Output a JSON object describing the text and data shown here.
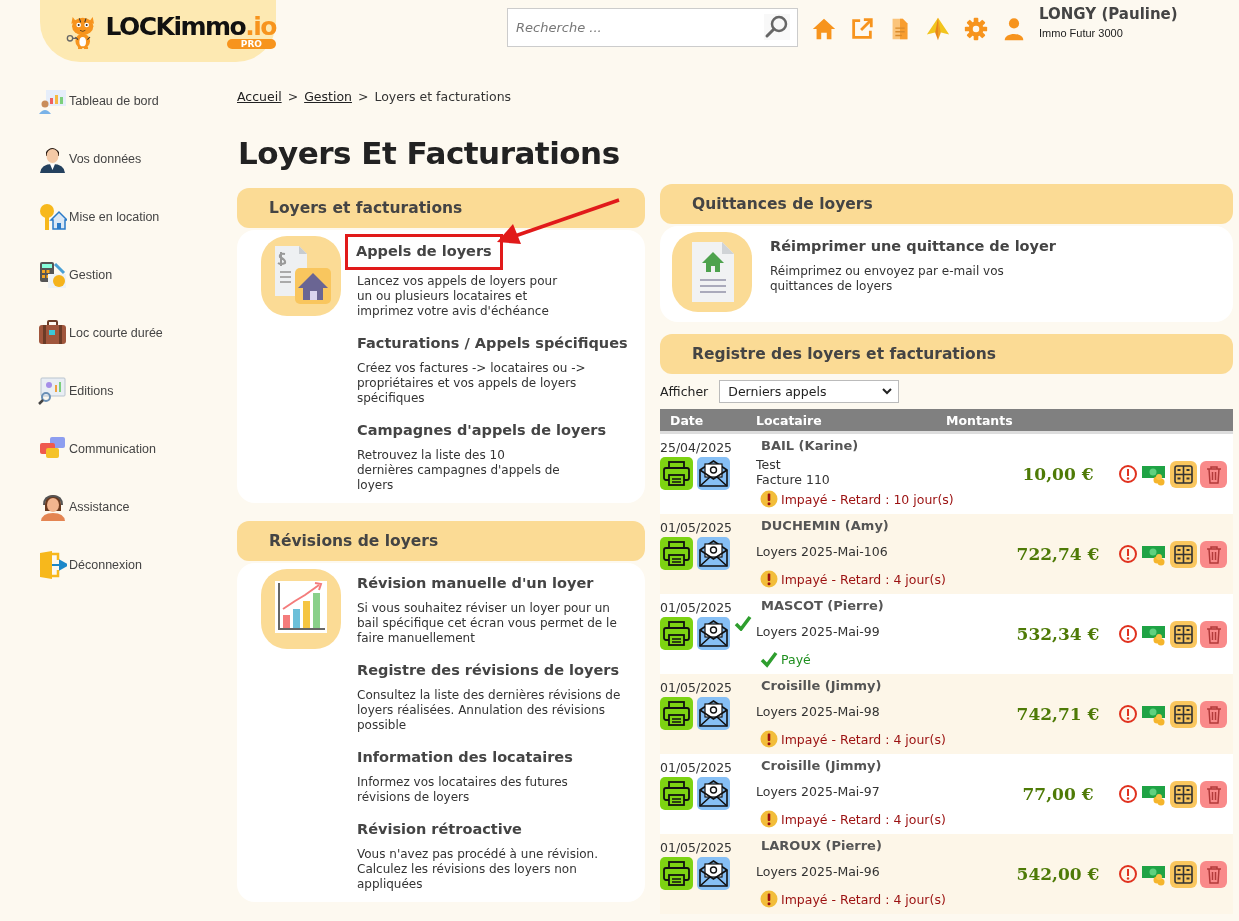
{
  "header": {
    "logo": {
      "name": "LOCKimmo",
      "suffix": ".io",
      "badge": "PRO"
    },
    "search": {
      "placeholder": "Recherche ..."
    },
    "user": {
      "name": "LONGY (Pauline)",
      "company": "Immo Futur 3000"
    }
  },
  "sidebar": {
    "items": [
      {
        "label": "Tableau de bord"
      },
      {
        "label": "Vos données"
      },
      {
        "label": "Mise en location"
      },
      {
        "label": "Gestion"
      },
      {
        "label": "Loc courte durée"
      },
      {
        "label": "Editions"
      },
      {
        "label": "Communication"
      },
      {
        "label": "Assistance"
      },
      {
        "label": "Déconnexion"
      }
    ]
  },
  "breadcrumb": {
    "separator": ">",
    "items": [
      {
        "label": "Accueil",
        "link": true
      },
      {
        "label": "Gestion",
        "link": true
      },
      {
        "label": "Loyers et facturations",
        "link": false
      }
    ]
  },
  "page_title": "Loyers Et Facturations",
  "left_panels": [
    {
      "title": "Loyers et facturations",
      "items": [
        {
          "title": "Appels de loyers",
          "description": "Lancez vos appels de loyers pour\nun ou plusieurs locataires et\nimprimez votre avis d'échéance",
          "highlighted": true
        },
        {
          "title": "Facturations / Appels spécifiques",
          "description": "Créez vos factures -> locataires ou ->\npropriétaires et vos appels de loyers\nspécifiques",
          "highlighted": false
        },
        {
          "title": "Campagnes d'appels de loyers",
          "description": "Retrouvez la liste des 10\ndernières campagnes d'appels de\nloyers",
          "highlighted": false
        }
      ]
    },
    {
      "title": "Révisions de loyers",
      "items": [
        {
          "title": "Révision manuelle d'un loyer",
          "description": "Si vous souhaitez réviser un loyer pour un\nbail spécifique cet écran vous permet de le\nfaire manuellement",
          "highlighted": false
        },
        {
          "title": "Registre des révisions de loyers",
          "description": "Consultez la liste des dernières révisions de\nloyers réalisées. Annulation des révisions\npossible",
          "highlighted": false
        },
        {
          "title": "Information des locataires",
          "description": "Informez vos locataires des futures\nrévisions de loyers",
          "highlighted": false
        },
        {
          "title": "Révision rétroactive",
          "description": "Vous n'avez pas procédé à une révision.\nCalculez les révisions des loyers non\nappliquées",
          "highlighted": false
        }
      ]
    }
  ],
  "receipts": {
    "title": "Quittances de loyers",
    "items": [
      {
        "title": "Réimprimer une quittance de loyer",
        "description": "Réimprimez ou envoyez par e-mail vos\nquittances de loyers",
        "highlighted": false
      }
    ]
  },
  "register": {
    "title": "Registre des loyers et facturations",
    "filter": {
      "label": "Afficher",
      "value": "Derniers appels"
    },
    "columns": [
      "Date",
      "Locataire",
      "Montants"
    ],
    "rows": [
      {
        "date": "25/04/2025",
        "tenant": "BAIL (Karine)",
        "lines": [
          "Test",
          "Facture 110"
        ],
        "status": {
          "kind": "unpaid",
          "text": "Impayé - Retard : 10 jour(s)"
        },
        "amount": "10,00 €",
        "sent": false
      },
      {
        "date": "01/05/2025",
        "tenant": "DUCHEMIN (Amy)",
        "lines": [
          "Loyers 2025-Mai-106"
        ],
        "status": {
          "kind": "unpaid",
          "text": "Impayé - Retard : 4 jour(s)"
        },
        "amount": "722,74 €",
        "sent": false
      },
      {
        "date": "01/05/2025",
        "tenant": "MASCOT (Pierre)",
        "lines": [
          "Loyers 2025-Mai-99"
        ],
        "status": {
          "kind": "paid",
          "text": "Payé"
        },
        "amount": "532,34 €",
        "sent": true
      },
      {
        "date": "01/05/2025",
        "tenant": "Croisille (Jimmy)",
        "lines": [
          "Loyers 2025-Mai-98"
        ],
        "status": {
          "kind": "unpaid",
          "text": "Impayé - Retard : 4 jour(s)"
        },
        "amount": "742,71 €",
        "sent": false
      },
      {
        "date": "01/05/2025",
        "tenant": "Croisille (Jimmy)",
        "lines": [
          "Loyers 2025-Mai-97"
        ],
        "status": {
          "kind": "unpaid",
          "text": "Impayé - Retard : 4 jour(s)"
        },
        "amount": "77,00 €",
        "sent": false
      },
      {
        "date": "01/05/2025",
        "tenant": "LAROUX (Pierre)",
        "lines": [
          "Loyers 2025-Mai-96"
        ],
        "status": {
          "kind": "unpaid",
          "text": "Impayé - Retard : 4 jour(s)"
        },
        "amount": "542,00 €",
        "sent": false
      }
    ]
  }
}
